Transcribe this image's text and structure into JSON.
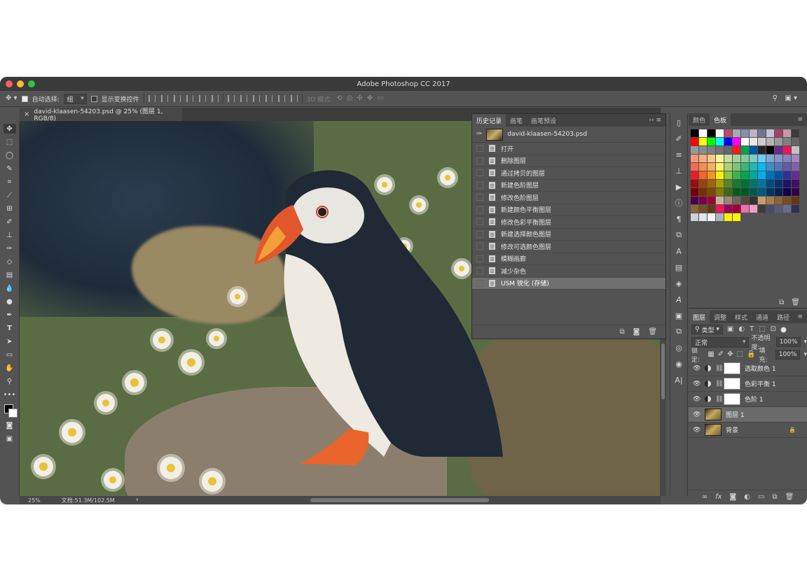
{
  "window": {
    "title": "Adobe Photoshop CC 2017"
  },
  "traffic_colors": [
    "#fe5f57",
    "#febc2e",
    "#28c840"
  ],
  "options": {
    "auto_select_label": "自动选择:",
    "auto_select_value": "组",
    "show_transform_label": "显示变换控件",
    "mode_3d_label": "3D 模式:"
  },
  "document": {
    "tab_title": "david-klaasen-54203.psd @ 25% (图层 1, RGB/8)",
    "zoom": "25%",
    "doc_size": "文档:51.3M/102.5M"
  },
  "history": {
    "tabs": [
      "历史记录",
      "画笔",
      "画笔预设"
    ],
    "snapshot": "david-klaasen-54203.psd",
    "items": [
      "打开",
      "删除图层",
      "通过拷贝的图层",
      "新建色阶图层",
      "修改色阶图层",
      "新建颜色平衡图层",
      "修改色彩平衡图层",
      "新建选择颜色图层",
      "修改可选颜色图层",
      "模糊画廊",
      "减少杂色",
      "USM 锐化 (存储)"
    ],
    "selected_index": 11
  },
  "swatches": {
    "tabs": [
      "颜色",
      "色板"
    ],
    "colors": [
      "#000000",
      "#ffffff",
      "#000000",
      "#ffffff",
      "#b94b6a",
      "#a8a8b8",
      "#8a8fb0",
      "#b9b3c8",
      "#707794",
      "#c6c2d5",
      "#a2446a",
      "#c39aa7",
      "#3c3c3c",
      "#ff0000",
      "#ffff00",
      "#00ff00",
      "#00ffff",
      "#0000ff",
      "#ff00ff",
      "#ffffff",
      "#e6e6e6",
      "#cccccc",
      "#b3b3b3",
      "#999999",
      "#808080",
      "#666666",
      "#999999",
      "#8c8c8c",
      "#808080",
      "#737373",
      "#666666",
      "#ff1a1a",
      "#00a651",
      "#0054a6",
      "#262626",
      "#000000",
      "#662d91",
      "#ed145b",
      "#c2c2c2",
      "#f7977a",
      "#f9ad81",
      "#fdc68a",
      "#fff79a",
      "#c4df9b",
      "#a2d39c",
      "#82ca9d",
      "#7bcdc8",
      "#6ecff6",
      "#7ea7d8",
      "#8493ca",
      "#8882be",
      "#a187be",
      "#f26c4f",
      "#f68e55",
      "#fbaf5c",
      "#fff467",
      "#acd372",
      "#7cc576",
      "#3bb878",
      "#1abbb4",
      "#00bff3",
      "#438ccb",
      "#5574b9",
      "#605ca8",
      "#855fa8",
      "#ed1c24",
      "#f26522",
      "#f7941d",
      "#fff200",
      "#8dc63f",
      "#39b54a",
      "#00a651",
      "#00a99d",
      "#00aeef",
      "#0072bc",
      "#0054a6",
      "#2e3192",
      "#662d91",
      "#9e0b0f",
      "#a0410d",
      "#a36209",
      "#aba000",
      "#598527",
      "#1a7b30",
      "#007236",
      "#00746b",
      "#0076a3",
      "#004b80",
      "#003471",
      "#1b1464",
      "#440e62",
      "#790000",
      "#7b2e00",
      "#7d4900",
      "#827b00",
      "#406618",
      "#005e20",
      "#005826",
      "#005952",
      "#005b7f",
      "#003663",
      "#002157",
      "#0d004c",
      "#32004b",
      "#4b0049",
      "#7b0046",
      "#9e0039",
      "#c7b299",
      "#998675",
      "#736357",
      "#534741",
      "#37302d",
      "#c69c6d",
      "#a67c52",
      "#8c6239",
      "#754c24",
      "#603913",
      "#8c6239",
      "#754c24",
      "#603913",
      "#ed145b",
      "#9e005d",
      "#9e0039",
      "#f06eaa",
      "#f49ac1",
      "#3c3c3c",
      "#4a4a6a",
      "#5a5a7a",
      "#6a6a8a",
      "#2f2f5f",
      "#c8d1dc",
      "#e0e6ec",
      "#f0f3f6",
      "#aab4c0",
      "#fff200",
      "#fff200"
    ]
  },
  "layers": {
    "tabs": [
      "图层",
      "调整",
      "样式",
      "通道",
      "路径"
    ],
    "filter_label": "类型",
    "blend_mode": "正常",
    "opacity_label": "不透明度:",
    "opacity": "100%",
    "lock_label": "锁定:",
    "fill_label": "填充:",
    "fill": "100%",
    "items": [
      {
        "name": "选取颜色 1",
        "kind": "adjustment"
      },
      {
        "name": "色彩平衡 1",
        "kind": "adjustment"
      },
      {
        "name": "色阶 1",
        "kind": "adjustment"
      },
      {
        "name": "图层 1",
        "kind": "pixel",
        "selected": true
      },
      {
        "name": "背景",
        "kind": "background",
        "locked": true
      }
    ]
  },
  "icons": {
    "tools": [
      "move-icon",
      "marquee-icon",
      "lasso-icon",
      "quick-select-icon",
      "crop-icon",
      "eyedropper-icon",
      "healing-icon",
      "brush-icon",
      "stamp-icon",
      "history-brush-icon",
      "eraser-icon",
      "gradient-icon",
      "blur-icon",
      "dodge-icon",
      "pen-icon",
      "type-icon",
      "path-select-icon",
      "shape-icon",
      "hand-icon",
      "zoom-icon",
      "more-icon"
    ]
  }
}
